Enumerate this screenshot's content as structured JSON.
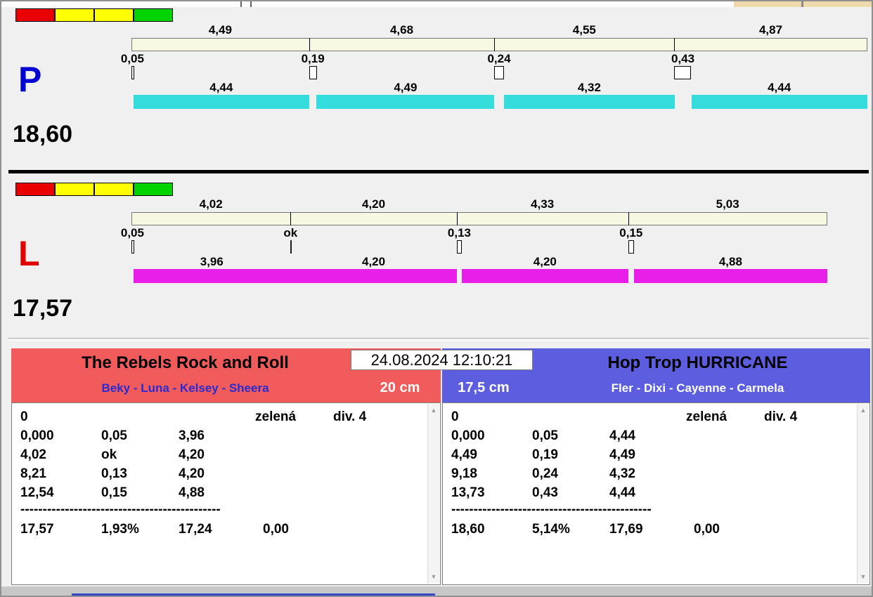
{
  "timestamp": "24.08.2024 12:10:21",
  "lanes": [
    {
      "letter": "P",
      "letter_color": "#0000d2",
      "total": "18,60",
      "total_seconds": 18.6,
      "bar_color": "#35dcdc",
      "lights": [
        "#ea0000",
        "#ffff00",
        "#ffff00",
        "#00d300"
      ],
      "runs": [
        {
          "split": "4,49",
          "split_v": 4.49,
          "cross": "0,05",
          "cross_v": 0.05,
          "dog": "4,44",
          "dog_v": 4.44
        },
        {
          "split": "4,68",
          "split_v": 4.68,
          "cross": "0,19",
          "cross_v": 0.19,
          "dog": "4,49",
          "dog_v": 4.49
        },
        {
          "split": "4,55",
          "split_v": 4.55,
          "cross": "0,24",
          "cross_v": 0.24,
          "dog": "4,32",
          "dog_v": 4.32
        },
        {
          "split": "4,87",
          "split_v": 4.87,
          "cross": "0,43",
          "cross_v": 0.43,
          "dog": "4,44",
          "dog_v": 4.44
        }
      ]
    },
    {
      "letter": "L",
      "letter_color": "#e10000",
      "total": "17,57",
      "total_seconds": 17.57,
      "bar_color": "#e81fe8",
      "lights": [
        "#ea0000",
        "#ffff00",
        "#ffff00",
        "#00d300"
      ],
      "runs": [
        {
          "split": "4,02",
          "split_v": 4.02,
          "cross": "0,05",
          "cross_v": 0.05,
          "dog": "3,96",
          "dog_v": 3.96
        },
        {
          "split": "4,20",
          "split_v": 4.2,
          "cross": "ok",
          "cross_v": 0.0,
          "dog": "4,20",
          "dog_v": 4.2
        },
        {
          "split": "4,33",
          "split_v": 4.33,
          "cross": "0,13",
          "cross_v": 0.13,
          "dog": "4,20",
          "dog_v": 4.2
        },
        {
          "split": "5,03",
          "split_v": 5.03,
          "cross": "0,15",
          "cross_v": 0.15,
          "dog": "4,88",
          "dog_v": 4.88
        }
      ]
    }
  ],
  "teams": [
    {
      "name": "The Rebels Rock and Roll",
      "dogs": "Beky - Luna - Kelsey - Sheera",
      "height": "20 cm",
      "header_color": "#f15b5b",
      "dogs_text_color": "#2a2ad0",
      "status": "0",
      "light_status": "zelená",
      "division": "div. 4",
      "rows": [
        [
          "0,000",
          "0,05",
          "3,96"
        ],
        [
          "4,02",
          "ok",
          "4,20"
        ],
        [
          "8,21",
          "0,13",
          "4,20"
        ],
        [
          "12,54",
          "0,15",
          "4,88"
        ]
      ],
      "separator": "---------------------------------------------",
      "summary": [
        "17,57",
        "1,93%",
        "17,24",
        "0,00"
      ]
    },
    {
      "name": "Hop Trop HURRICANE",
      "dogs": "Fler - Dixi - Cayenne - Carmela",
      "height": "17,5 cm",
      "header_color": "#5d5de0",
      "dogs_text_color": "#ffffff",
      "status": "0",
      "light_status": "zelená",
      "division": "div. 4",
      "rows": [
        [
          "0,000",
          "0,05",
          "4,44"
        ],
        [
          "4,49",
          "0,19",
          "4,49"
        ],
        [
          "9,18",
          "0,24",
          "4,32"
        ],
        [
          "13,73",
          "0,43",
          "4,44"
        ]
      ],
      "separator": "---------------------------------------------",
      "summary": [
        "18,60",
        "5,14%",
        "17,69",
        "0,00"
      ]
    }
  ]
}
